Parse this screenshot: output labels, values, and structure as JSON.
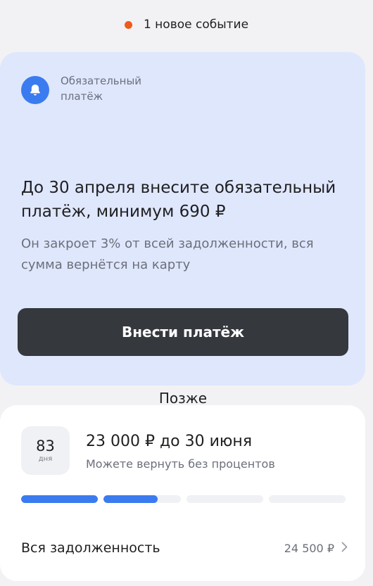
{
  "events": {
    "text": "1 новое событие"
  },
  "notice": {
    "type_label": "Обязательный платёж",
    "title": "До 30 апреля внесите обязательный платёж, минимум 690 ₽",
    "subtitle": "Он закроет 3% от всей задолженности, вся сумма вернётся на карту",
    "pay_button": "Внести платёж",
    "later_button": "Позже"
  },
  "loan": {
    "days_value": "83",
    "days_unit": "дня",
    "amount_text": "23 000 ₽ до 30 июня",
    "subtitle": "Можете вернуть без процентов",
    "progress_segments": [
      1,
      0.7,
      0,
      0
    ],
    "total_label": "Вся задолженность",
    "total_value": "24 500 ₽"
  },
  "colors": {
    "accent": "#3b7bf0",
    "event_dot": "#f05a1a",
    "notice_bg": "#dfe7fd",
    "primary_button": "#35383c"
  }
}
